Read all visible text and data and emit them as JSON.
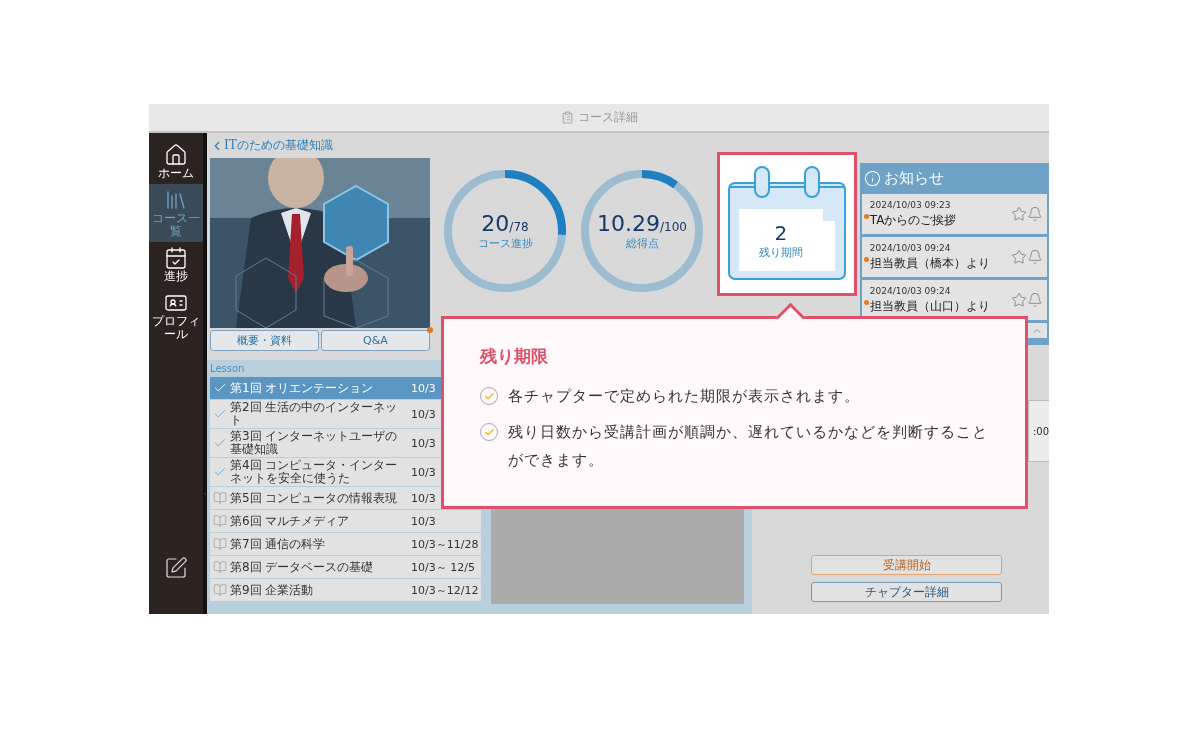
{
  "window": {
    "title": "コース詳細"
  },
  "sidebar": {
    "items": [
      {
        "label": "ホーム",
        "selected": false
      },
      {
        "label": "コース一覧",
        "selected": true
      },
      {
        "label": "進捗",
        "selected": false
      },
      {
        "label": "プロフィール",
        "selected": false
      }
    ]
  },
  "course": {
    "back_label": "ITのための基礎知識",
    "buttons": [
      {
        "label": "概要・資料",
        "badge": false
      },
      {
        "label": "Q&A",
        "badge": true
      }
    ]
  },
  "progress": [
    {
      "value": "20",
      "total": "/78",
      "label": "コース進捗",
      "level": 0.26
    },
    {
      "value": "10.29",
      "total": "/100",
      "label": "総得点",
      "level": 0.1
    }
  ],
  "remaining": {
    "value": "2",
    "label": "残り期間",
    "highlighted": true
  },
  "notices": {
    "title": "お知らせ",
    "items": [
      {
        "date": "2024/10/03 09:23",
        "title": "TAからのご挨拶",
        "color": "#e07b22"
      },
      {
        "date": "2024/10/03 09:24",
        "title": "担当教員（橋本）より",
        "color": "#e07b22"
      },
      {
        "date": "2024/10/03 09:24",
        "title": "担当教員（山口）より",
        "color": "#e07b22"
      }
    ]
  },
  "lessons": {
    "title": "Lesson",
    "items": [
      {
        "title": "第1回 オリエンテーション",
        "period": "10/3",
        "completed": true,
        "selected": true
      },
      {
        "title": "第2回 生活の中のインターネット",
        "period": "10/3",
        "completed": true,
        "selected": false
      },
      {
        "title": "第3回 インターネットユーザの基礎知識",
        "period": "10/3",
        "completed": true,
        "selected": false
      },
      {
        "title": "第4回 コンピュータ・インターネットを安全に使うた",
        "period": "10/3",
        "completed": true,
        "selected": false
      },
      {
        "title": "第5回 コンピュータの情報表現",
        "period": "10/3",
        "completed": false,
        "selected": false
      },
      {
        "title": "第6回 マルチメディア",
        "period": "10/3",
        "completed": false,
        "selected": false
      },
      {
        "title": "第7回 通信の科学",
        "period": "10/3～11/28",
        "completed": false,
        "selected": false
      },
      {
        "title": "第8回 データベースの基礎",
        "period": "10/3～ 12/5",
        "completed": false,
        "selected": false
      },
      {
        "title": "第9回 企業活動",
        "period": "10/3～12/12",
        "completed": false,
        "selected": false
      }
    ]
  },
  "side_panel": {
    "time": ":00"
  },
  "actions": [
    {
      "label": "受講開始",
      "kind": "primary"
    },
    {
      "label": "チャプター詳細",
      "kind": "secondary"
    }
  ],
  "callout": {
    "title": "残り期限",
    "points": [
      "各チャプターで定められた期限が表示されます。",
      "残り日数から受講計画が順調か、遅れているかなどを判断することができます。"
    ]
  }
}
